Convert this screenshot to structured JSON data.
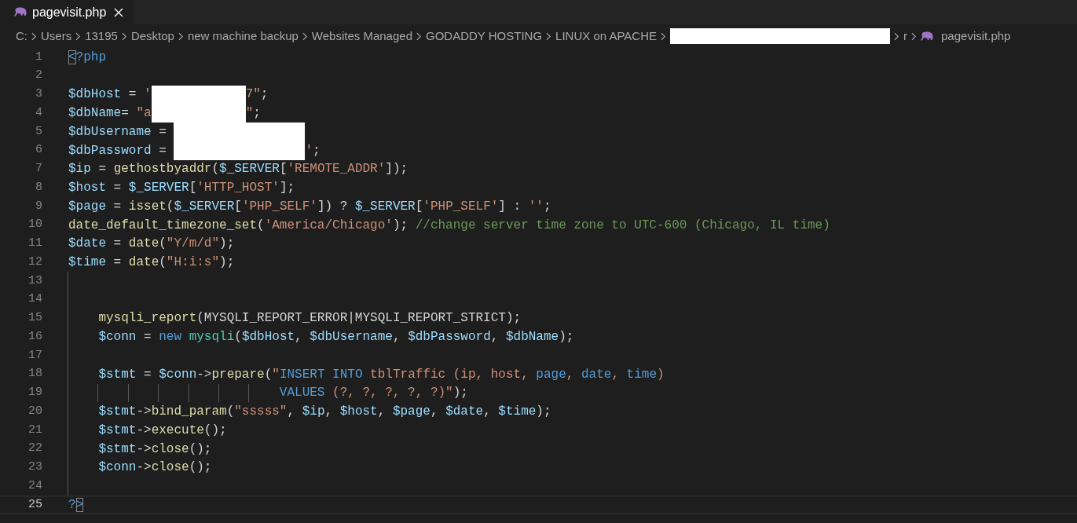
{
  "tab": {
    "label": "pagevisit.php",
    "selected": true
  },
  "breadcrumb": [
    {
      "kind": "folder",
      "text": "C:"
    },
    {
      "kind": "folder",
      "text": "Users"
    },
    {
      "kind": "folder",
      "text": "13195"
    },
    {
      "kind": "folder",
      "text": "Desktop"
    },
    {
      "kind": "folder",
      "text": "new machine backup"
    },
    {
      "kind": "folder",
      "text": "Websites Managed"
    },
    {
      "kind": "folder",
      "text": "GODADDY HOSTING"
    },
    {
      "kind": "folder",
      "text": "LINUX on APACHE"
    },
    {
      "kind": "redacted"
    },
    {
      "kind": "folder",
      "text": "r"
    },
    {
      "kind": "file",
      "text": "pagevisit.php"
    }
  ],
  "lines": [
    {
      "number": "1",
      "current": false,
      "indent_guide": false,
      "tokens": [
        {
          "kind": "bracket",
          "text": "<"
        },
        {
          "kind": "tag",
          "text": "?php"
        }
      ]
    },
    {
      "number": "2",
      "current": false,
      "indent_guide": false
    },
    {
      "number": "3",
      "current": false,
      "indent_guide": false,
      "tokens": [
        {
          "kind": "var",
          "text": "$dbHost"
        },
        {
          "kind": "plain",
          "text": " = "
        },
        {
          "kind": "string",
          "text": "'"
        },
        {
          "kind": "redacted_short"
        },
        {
          "kind": "string",
          "text": "7\""
        },
        {
          "kind": "plain",
          "text": ";"
        }
      ]
    },
    {
      "number": "4",
      "current": false,
      "indent_guide": false,
      "tokens": [
        {
          "kind": "var",
          "text": "$dbName"
        },
        {
          "kind": "plain",
          "text": "= "
        },
        {
          "kind": "string",
          "text": "\"a"
        },
        {
          "kind": "redacted_short"
        },
        {
          "kind": "string",
          "text": "\""
        },
        {
          "kind": "plain",
          "text": ";"
        }
      ]
    },
    {
      "number": "5",
      "current": false,
      "indent_guide": false,
      "tokens": [
        {
          "kind": "var",
          "text": "$dbUsername"
        },
        {
          "kind": "plain",
          "text": " = "
        },
        {
          "kind": "redacted_long"
        }
      ]
    },
    {
      "number": "6",
      "current": false,
      "indent_guide": false,
      "tokens": [
        {
          "kind": "var",
          "text": "$dbPassword"
        },
        {
          "kind": "plain",
          "text": " = "
        },
        {
          "kind": "redacted_long"
        },
        {
          "kind": "string",
          "text": "'"
        },
        {
          "kind": "plain",
          "text": ";"
        }
      ]
    },
    {
      "number": "7",
      "current": false,
      "indent_guide": false,
      "tokens": [
        {
          "kind": "var",
          "text": "$ip"
        },
        {
          "kind": "plain",
          "text": " = "
        },
        {
          "kind": "func",
          "text": "gethostbyaddr"
        },
        {
          "kind": "plain",
          "text": "("
        },
        {
          "kind": "var",
          "text": "$_SERVER"
        },
        {
          "kind": "plain",
          "text": "["
        },
        {
          "kind": "string",
          "text": "'REMOTE_ADDR'"
        },
        {
          "kind": "plain",
          "text": "]);"
        }
      ]
    },
    {
      "number": "8",
      "current": false,
      "indent_guide": false,
      "tokens": [
        {
          "kind": "var",
          "text": "$host"
        },
        {
          "kind": "plain",
          "text": " = "
        },
        {
          "kind": "var",
          "text": "$_SERVER"
        },
        {
          "kind": "plain",
          "text": "["
        },
        {
          "kind": "string",
          "text": "'HTTP_HOST'"
        },
        {
          "kind": "plain",
          "text": "];"
        }
      ]
    },
    {
      "number": "9",
      "current": false,
      "indent_guide": false,
      "tokens": [
        {
          "kind": "var",
          "text": "$page"
        },
        {
          "kind": "plain",
          "text": " = "
        },
        {
          "kind": "func",
          "text": "isset"
        },
        {
          "kind": "plain",
          "text": "("
        },
        {
          "kind": "var",
          "text": "$_SERVER"
        },
        {
          "kind": "plain",
          "text": "["
        },
        {
          "kind": "string",
          "text": "'PHP_SELF'"
        },
        {
          "kind": "plain",
          "text": "]) ? "
        },
        {
          "kind": "var",
          "text": "$_SERVER"
        },
        {
          "kind": "plain",
          "text": "["
        },
        {
          "kind": "string",
          "text": "'PHP_SELF'"
        },
        {
          "kind": "plain",
          "text": "] : "
        },
        {
          "kind": "string",
          "text": "''"
        },
        {
          "kind": "plain",
          "text": ";"
        }
      ]
    },
    {
      "number": "10",
      "current": false,
      "indent_guide": false,
      "tokens": [
        {
          "kind": "func",
          "text": "date_default_timezone_set"
        },
        {
          "kind": "plain",
          "text": "("
        },
        {
          "kind": "string",
          "text": "'America/Chicago'"
        },
        {
          "kind": "plain",
          "text": "); "
        },
        {
          "kind": "comment",
          "text": "//change server time zone to UTC-600 (Chicago, IL time)"
        }
      ]
    },
    {
      "number": "11",
      "current": false,
      "indent_guide": false,
      "tokens": [
        {
          "kind": "var",
          "text": "$date"
        },
        {
          "kind": "plain",
          "text": " = "
        },
        {
          "kind": "func",
          "text": "date"
        },
        {
          "kind": "plain",
          "text": "("
        },
        {
          "kind": "string",
          "text": "\"Y/m/d\""
        },
        {
          "kind": "plain",
          "text": ");"
        }
      ]
    },
    {
      "number": "12",
      "current": false,
      "indent_guide": false,
      "tokens": [
        {
          "kind": "var",
          "text": "$time"
        },
        {
          "kind": "plain",
          "text": " = "
        },
        {
          "kind": "func",
          "text": "date"
        },
        {
          "kind": "plain",
          "text": "("
        },
        {
          "kind": "string",
          "text": "\"H:i:s\""
        },
        {
          "kind": "plain",
          "text": ");"
        }
      ]
    },
    {
      "number": "13",
      "current": false,
      "indent_guide": true
    },
    {
      "number": "14",
      "current": false,
      "indent_guide": true
    },
    {
      "number": "15",
      "current": false,
      "indent_guide": true,
      "tokens": [
        {
          "kind": "func",
          "text": "    mysqli_report"
        },
        {
          "kind": "plain",
          "text": "(MYSQLI_REPORT_ERROR|MYSQLI_REPORT_STRICT);"
        }
      ]
    },
    {
      "number": "16",
      "current": false,
      "indent_guide": true,
      "tokens": [
        {
          "kind": "var",
          "text": "    $conn"
        },
        {
          "kind": "plain",
          "text": " = "
        },
        {
          "kind": "keyword",
          "text": "new"
        },
        {
          "kind": "class",
          "text": " mysqli"
        },
        {
          "kind": "plain",
          "text": "("
        },
        {
          "kind": "var",
          "text": "$dbHost"
        },
        {
          "kind": "plain",
          "text": ", "
        },
        {
          "kind": "var",
          "text": "$dbUsername"
        },
        {
          "kind": "plain",
          "text": ", "
        },
        {
          "kind": "var",
          "text": "$dbPassword"
        },
        {
          "kind": "plain",
          "text": ", "
        },
        {
          "kind": "var",
          "text": "$dbName"
        },
        {
          "kind": "plain",
          "text": ");"
        }
      ]
    },
    {
      "number": "17",
      "current": false,
      "indent_guide": true
    },
    {
      "number": "18",
      "current": false,
      "indent_guide": true,
      "tokens": [
        {
          "kind": "var",
          "text": "    $stmt"
        },
        {
          "kind": "plain",
          "text": " = "
        },
        {
          "kind": "var",
          "text": "$conn"
        },
        {
          "kind": "plain",
          "text": "->"
        },
        {
          "kind": "func",
          "text": "prepare"
        },
        {
          "kind": "plain",
          "text": "("
        },
        {
          "kind": "string",
          "text": "\""
        },
        {
          "kind": "keyword",
          "text": "INSERT INTO"
        },
        {
          "kind": "string",
          "text": " tblTraffic (ip, host, "
        },
        {
          "kind": "keyword",
          "text": "page"
        },
        {
          "kind": "string",
          "text": ", "
        },
        {
          "kind": "keyword",
          "text": "date"
        },
        {
          "kind": "string",
          "text": ", "
        },
        {
          "kind": "keyword",
          "text": "time"
        },
        {
          "kind": "string",
          "text": ")"
        }
      ]
    },
    {
      "number": "19",
      "current": false,
      "indent_guide": true,
      "tokens": [
        {
          "kind": "keyword",
          "text": "                            VALUES"
        },
        {
          "kind": "string",
          "text": " (?, ?, ?, ?, ?)\""
        },
        {
          "kind": "plain",
          "text": ");"
        }
      ]
    },
    {
      "number": "20",
      "current": false,
      "indent_guide": true,
      "tokens": [
        {
          "kind": "var",
          "text": "    $stmt"
        },
        {
          "kind": "plain",
          "text": "->"
        },
        {
          "kind": "func",
          "text": "bind_param"
        },
        {
          "kind": "plain",
          "text": "("
        },
        {
          "kind": "string",
          "text": "\"sssss\""
        },
        {
          "kind": "plain",
          "text": ", "
        },
        {
          "kind": "var",
          "text": "$ip"
        },
        {
          "kind": "plain",
          "text": ", "
        },
        {
          "kind": "var",
          "text": "$host"
        },
        {
          "kind": "plain",
          "text": ", "
        },
        {
          "kind": "var",
          "text": "$page"
        },
        {
          "kind": "plain",
          "text": ", "
        },
        {
          "kind": "var",
          "text": "$date"
        },
        {
          "kind": "plain",
          "text": ", "
        },
        {
          "kind": "var",
          "text": "$time"
        },
        {
          "kind": "plain",
          "text": ");"
        }
      ]
    },
    {
      "number": "21",
      "current": false,
      "indent_guide": true,
      "tokens": [
        {
          "kind": "var",
          "text": "    $stmt"
        },
        {
          "kind": "plain",
          "text": "->"
        },
        {
          "kind": "func",
          "text": "execute"
        },
        {
          "kind": "plain",
          "text": "();"
        }
      ]
    },
    {
      "number": "22",
      "current": false,
      "indent_guide": true,
      "tokens": [
        {
          "kind": "var",
          "text": "    $stmt"
        },
        {
          "kind": "plain",
          "text": "->"
        },
        {
          "kind": "func",
          "text": "close"
        },
        {
          "kind": "plain",
          "text": "();"
        }
      ]
    },
    {
      "number": "23",
      "current": false,
      "indent_guide": true,
      "tokens": [
        {
          "kind": "var",
          "text": "    $conn"
        },
        {
          "kind": "plain",
          "text": "->"
        },
        {
          "kind": "func",
          "text": "close"
        },
        {
          "kind": "plain",
          "text": "();"
        }
      ]
    },
    {
      "number": "24",
      "current": false,
      "indent_guide": true
    },
    {
      "number": "25",
      "current": true,
      "indent_guide": false,
      "tokens": [
        {
          "kind": "tag",
          "text": "?"
        },
        {
          "kind": "bracket",
          "text": ">"
        }
      ]
    }
  ]
}
